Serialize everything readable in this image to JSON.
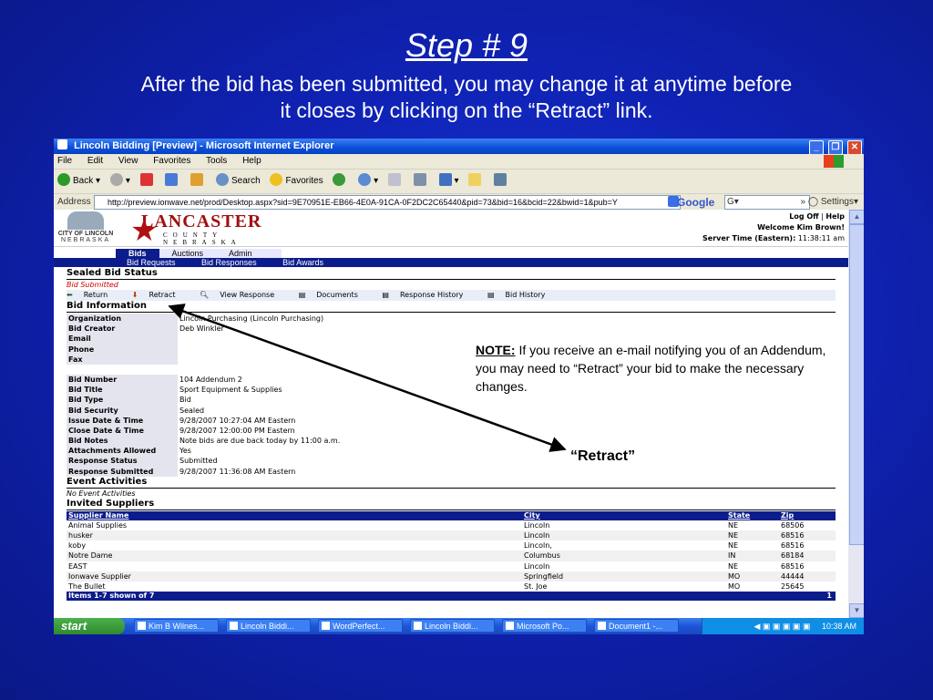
{
  "slide": {
    "title": "Step # 9",
    "subtitle_line1": "After the bid has been submitted, you may change it at anytime before",
    "subtitle_line2": "it closes by clicking on the “Retract” link."
  },
  "browser": {
    "title": "Lincoln Bidding [Preview] - Microsoft Internet Explorer",
    "menu": [
      "File",
      "Edit",
      "View",
      "Favorites",
      "Tools",
      "Help"
    ],
    "toolbar": {
      "back": "Back",
      "search": "Search",
      "favorites": "Favorites"
    },
    "address_label": "Address",
    "url": "http://preview.ionwave.net/prod/Desktop.aspx?sid=9E70951E-EB66-4E0A-91CA-0F2DC2C65440&pid=73&bid=16&bcid=22&bwid=1&pub=Y",
    "google_label": "Google",
    "google_field": "G▾",
    "settings": "Settings▾"
  },
  "site": {
    "city_logo": "CITY OF LINCOLN",
    "city_logo_sub": "NEBRASKA",
    "lancaster": "LANCASTER",
    "county": "COUNTY",
    "nebraska": "NEBRASKA",
    "logoff": "Log Off",
    "help": "Help",
    "welcome": "Welcome Kim Brown!",
    "server_time_label": "Server Time (Eastern):",
    "server_time": "11:38:11 am",
    "tabs": [
      "Bids",
      "Auctions",
      "Admin"
    ],
    "subnav": [
      "Bid Requests",
      "Bid Responses",
      "Bid Awards"
    ]
  },
  "page": {
    "sealed_status_title": "Sealed Bid Status",
    "status_text": "Bid Submitted",
    "actions": [
      "Return",
      "Retract",
      "View Response",
      "Documents",
      "Response History",
      "Bid History"
    ],
    "bid_info_title": "Bid Information",
    "bid_info": [
      {
        "k": "Organization",
        "v": "Lincoln Purchasing (Lincoln Purchasing)"
      },
      {
        "k": "Bid Creator",
        "v": "Deb Winkler"
      },
      {
        "k": "Email",
        "v": ""
      },
      {
        "k": "Phone",
        "v": ""
      },
      {
        "k": "Fax",
        "v": ""
      }
    ],
    "bid_details": [
      {
        "k": "Bid Number",
        "v": "104 Addendum 2"
      },
      {
        "k": "Bid Title",
        "v": "Sport Equipment & Supplies"
      },
      {
        "k": "Bid Type",
        "v": "Bid"
      },
      {
        "k": "Bid Security",
        "v": "Sealed"
      },
      {
        "k": "Issue Date & Time",
        "v": "9/28/2007 10:27:04 AM Eastern"
      },
      {
        "k": "Close Date & Time",
        "v": "9/28/2007 12:00:00 PM Eastern"
      },
      {
        "k": "Bid Notes",
        "v": "Note bids are due back today by 11:00 a.m."
      },
      {
        "k": "Attachments Allowed",
        "v": "Yes"
      },
      {
        "k": "Response Status",
        "v": "Submitted"
      },
      {
        "k": "Response Submitted",
        "v": "9/28/2007 11:36:08 AM Eastern"
      }
    ],
    "event_title": "Event Activities",
    "event_text": "No Event Activities",
    "suppliers_title": "Invited Suppliers",
    "supplier_headers": [
      "Supplier Name",
      "City",
      "State",
      "Zip"
    ],
    "suppliers": [
      [
        "Animal Supplies",
        "Lincoln",
        "NE",
        "68506"
      ],
      [
        "husker",
        "Lincoln",
        "NE",
        "68516"
      ],
      [
        "koby",
        "Lincoln,",
        "NE",
        "68516"
      ],
      [
        "Notre Dame",
        "Columbus",
        "IN",
        "68184"
      ],
      [
        "EAST",
        "Lincoln",
        "NE",
        "68516"
      ],
      [
        "Ionwave Supplier",
        "Springfield",
        "MO",
        "44444"
      ],
      [
        "The Bullet",
        "St. Joe",
        "MO",
        "25645"
      ]
    ],
    "items_shown": "Items 1-7 shown of 7",
    "page_num": "1"
  },
  "taskbar": {
    "start": "start",
    "tasks": [
      "Kim B Wilnes...",
      "Lincoln Biddi...",
      "WordPerfect...",
      "Lincoln Biddi...",
      "Microsoft Po...",
      "Document1 -..."
    ],
    "clock": "10:38 AM"
  },
  "callouts": {
    "note_label": "NOTE:",
    "note_text": " If you receive an e-mail notifying you of an Addendum, you may need to “Retract” your bid to make the necessary changes.",
    "retract": "“Retract”"
  }
}
